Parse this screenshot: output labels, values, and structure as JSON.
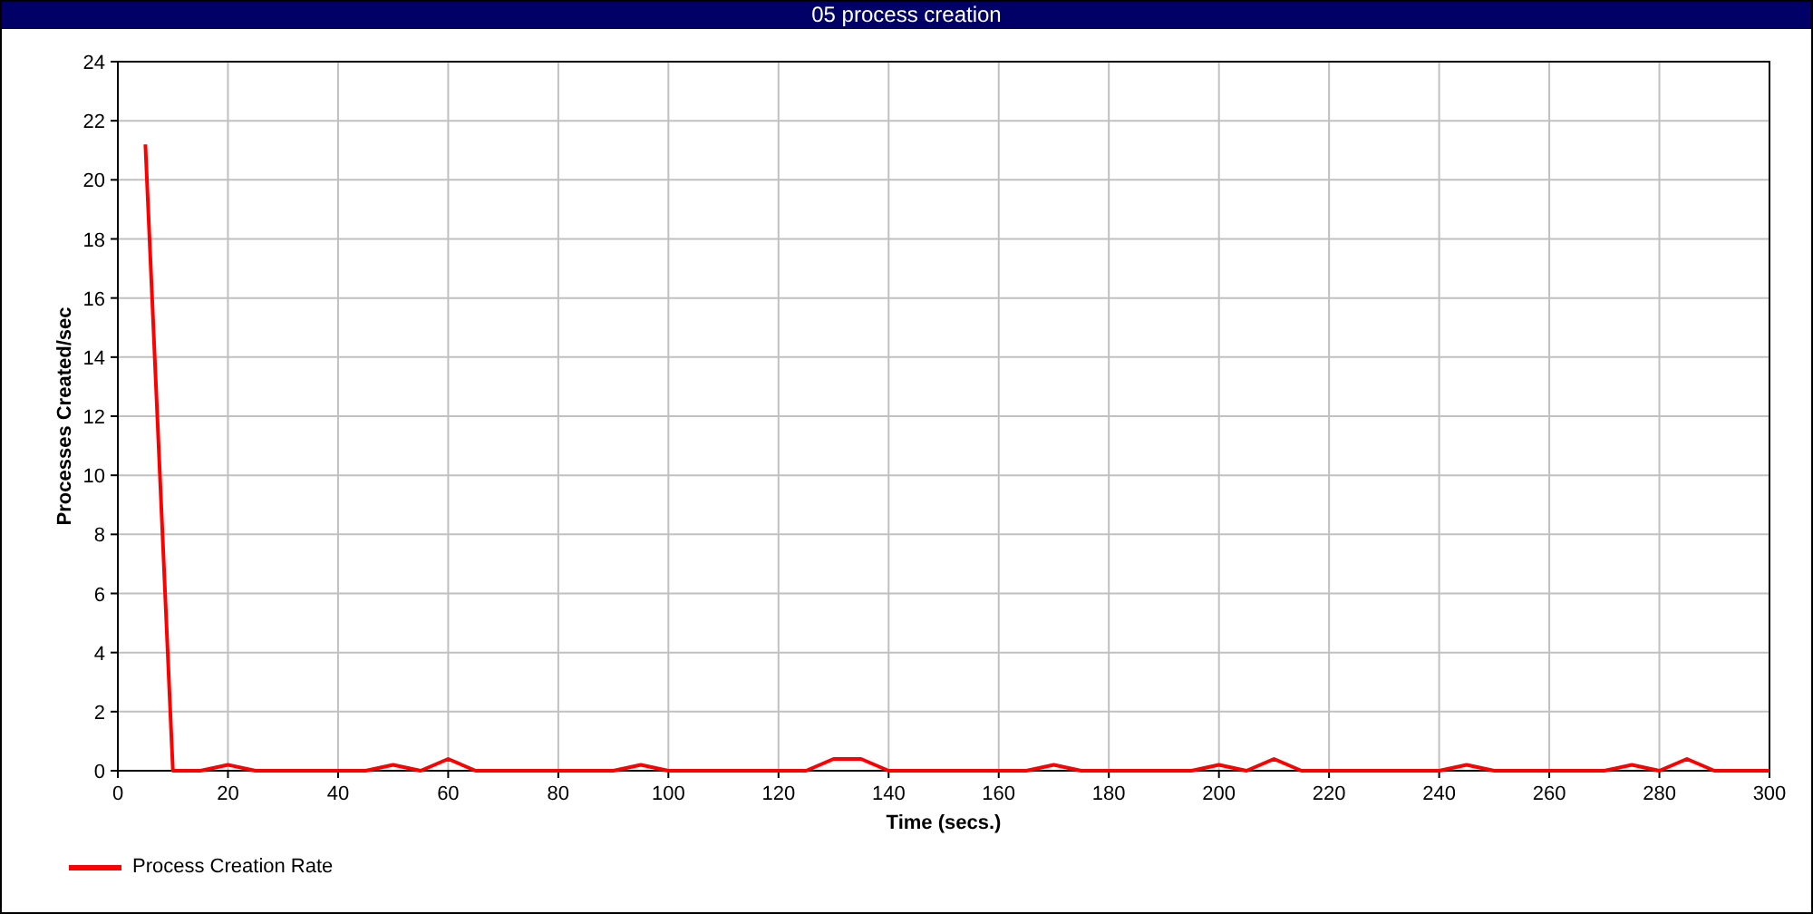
{
  "window": {
    "title": "05 process creation"
  },
  "chart": {
    "chart_data": {
      "type": "line",
      "xlabel": "Time (secs.)",
      "ylabel": "Processes Created/sec",
      "grid": true,
      "xlim": [
        0,
        300
      ],
      "ylim": [
        0,
        24
      ],
      "xticks": [
        0,
        20,
        40,
        60,
        80,
        100,
        120,
        140,
        160,
        180,
        200,
        220,
        240,
        260,
        280,
        300
      ],
      "yticks": [
        0,
        2,
        4,
        6,
        8,
        10,
        12,
        14,
        16,
        18,
        20,
        22,
        24
      ],
      "x": [
        5,
        10,
        15,
        20,
        25,
        30,
        35,
        40,
        45,
        50,
        55,
        60,
        65,
        70,
        75,
        80,
        85,
        90,
        95,
        100,
        105,
        110,
        115,
        120,
        125,
        130,
        135,
        140,
        145,
        150,
        155,
        160,
        165,
        170,
        175,
        180,
        185,
        190,
        195,
        200,
        205,
        210,
        215,
        220,
        225,
        230,
        235,
        240,
        245,
        250,
        255,
        260,
        265,
        270,
        275,
        280,
        285,
        290,
        295,
        300
      ],
      "series": [
        {
          "name": "Process Creation Rate",
          "color": "#ff0000",
          "values": [
            21.2,
            0,
            0,
            0.2,
            0,
            0,
            0,
            0,
            0,
            0.2,
            0,
            0.4,
            0,
            0,
            0,
            0,
            0,
            0,
            0.2,
            0,
            0,
            0,
            0,
            0,
            0,
            0.4,
            0.4,
            0,
            0,
            0,
            0,
            0,
            0,
            0.2,
            0,
            0,
            0,
            0,
            0,
            0.2,
            0,
            0.4,
            0,
            0,
            0,
            0,
            0,
            0,
            0.2,
            0,
            0,
            0,
            0,
            0,
            0.2,
            0,
            0.4,
            0,
            0,
            0
          ]
        }
      ]
    }
  }
}
